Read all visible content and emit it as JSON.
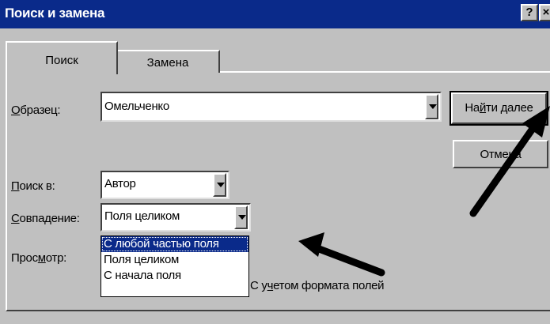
{
  "window": {
    "title": "Поиск и замена",
    "help": "?",
    "close": "×"
  },
  "tabs": [
    {
      "label": "Поиск",
      "active": true
    },
    {
      "label": "Замена",
      "active": false
    }
  ],
  "pattern": {
    "label_accel": "О",
    "label_rest": "бразец:",
    "value": "Омельченко"
  },
  "search_in": {
    "label_accel": "П",
    "label_rest": "оиск в:",
    "value": "Автор"
  },
  "match": {
    "label_accel": "С",
    "label_rest": "овпадение:",
    "value": "Поля целиком",
    "options": [
      "С любой частью поля",
      "Поля целиком",
      "С начала поля"
    ],
    "highlighted_index": 0
  },
  "browse": {
    "label_pre": "Прос",
    "label_accel": "м",
    "label_post": "отр:"
  },
  "buttons": {
    "find_pre": "На",
    "find_accel": "й",
    "find_post": "ти далее",
    "cancel": "Отмена"
  },
  "format_option": {
    "label_pre": "С у",
    "label_accel": "ч",
    "label_post": "етом формата полей"
  },
  "colors": {
    "titlebar": "#0a2a8a",
    "dialog": "#c0c0c0",
    "highlight": "#0a2a8a"
  }
}
